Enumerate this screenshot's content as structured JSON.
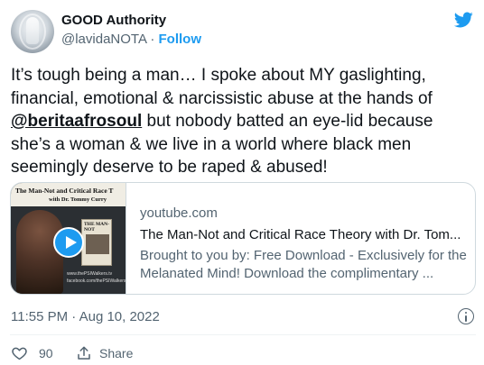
{
  "author": {
    "name": "GOOD Authority",
    "handle": "@lavidaNOTA",
    "separator": "·",
    "follow_label": "Follow",
    "avatar_icon": "profile-avatar"
  },
  "brand": {
    "icon": "twitter-bird-icon",
    "color": "#1d9bf0"
  },
  "tweet": {
    "text_before": "It’s tough being a man… I spoke about MY gaslighting, financial, emotional & narcissistic abuse at the hands of ",
    "mention": "@beritaafrosoul",
    "text_after": " but nobody batted an eye-lid because she’s a woman & we live in a world where black men seemingly deserve to be raped & abused!"
  },
  "card": {
    "domain": "youtube.com",
    "title": "The Man-Not and Critical Race Theory with Dr. Tom...",
    "description": "Brought to you by: Free Download - Exclusively for the Melanated Mind! Download the complimentary ...",
    "thumbnail": {
      "headline": "The Man-Not and Critical Race T",
      "subhead": "with Dr. Tommy Curry",
      "book_title": "THE MAN-NOT",
      "site_line1": "www.thePSIWalkers.tv",
      "site_line2": "facebook.com/thePSIWalkers"
    },
    "play_icon": "play-icon"
  },
  "meta": {
    "timestamp": "11:55 PM · Aug 10, 2022",
    "info_icon": "info-icon"
  },
  "actions": {
    "like_count": "90",
    "like_icon": "heart-icon",
    "share_label": "Share",
    "share_icon": "share-icon"
  },
  "colors": {
    "text_primary": "#0f1419",
    "text_secondary": "#536471",
    "accent": "#1d9bf0",
    "border": "#cfd9de"
  }
}
